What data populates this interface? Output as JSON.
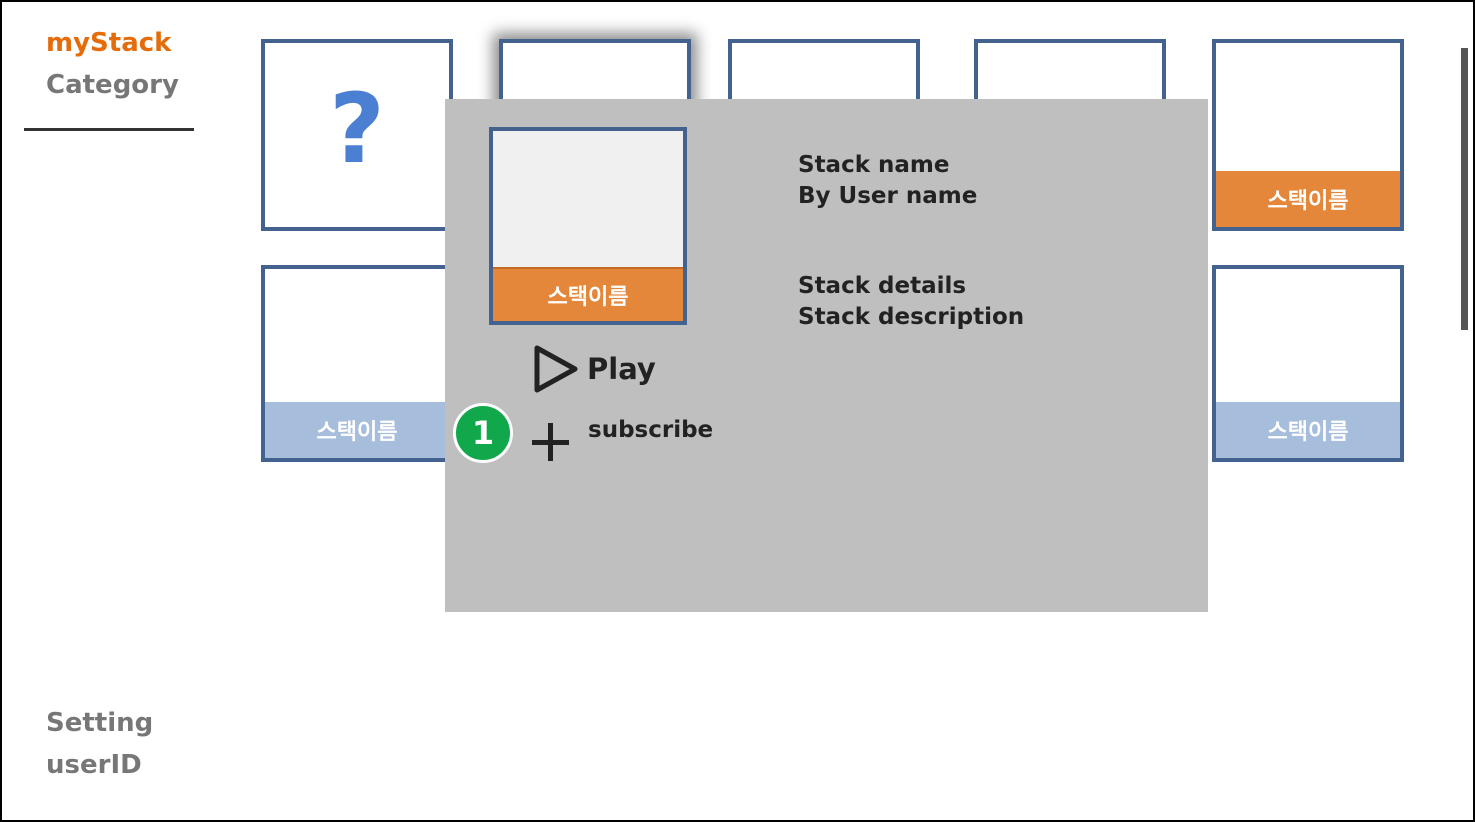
{
  "sidebar": {
    "top_items": [
      "myStack",
      "Category"
    ],
    "bottom_items": [
      "Setting",
      "userID"
    ]
  },
  "grid": {
    "unknown_tile_symbol": "?",
    "row1_right_label": "스택이름",
    "row2_left_label": "스택이름",
    "row2_right_label": "스택이름"
  },
  "modal": {
    "thumb_label": "스택이름",
    "stack_name": "Stack name",
    "by_user": "By User name",
    "details": "Stack details",
    "description": "Stack description",
    "play_label": "Play",
    "subscribe_label": "subscribe"
  },
  "annotation": {
    "badge": "1"
  },
  "colors": {
    "accent_orange": "#e5873b",
    "tile_border": "#44628f",
    "label_blue": "#a7bddc",
    "modal_bg": "#bfbfbf",
    "badge_green": "#10a84a",
    "nav_active": "#e46c0a"
  },
  "icons": [
    "question-icon",
    "play-icon",
    "plus-icon"
  ]
}
